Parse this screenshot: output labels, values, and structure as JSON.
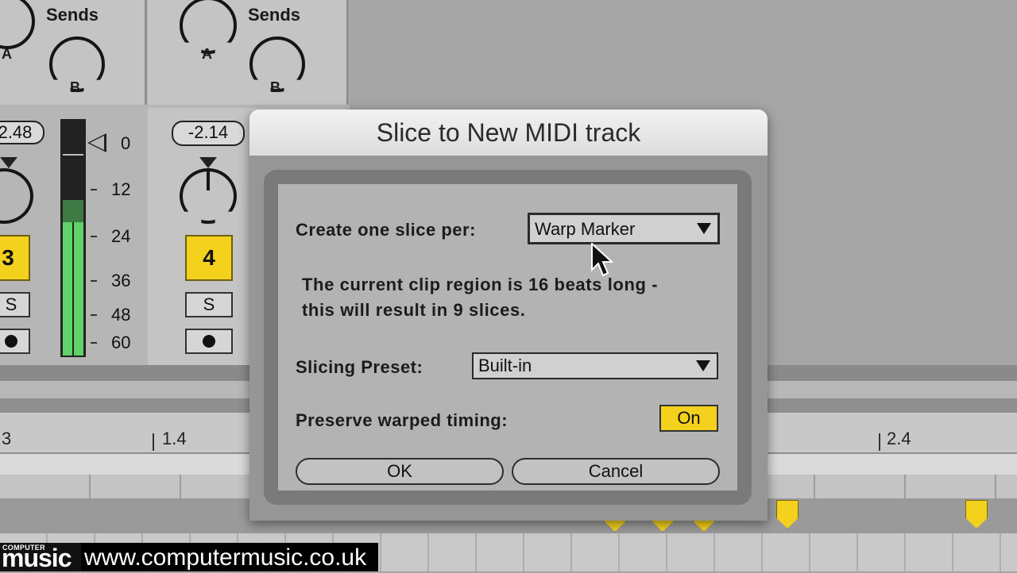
{
  "mixer": {
    "sends_title": "Sends",
    "knob_a": "A",
    "knob_b": "B",
    "tracks": [
      {
        "volume": "2.48",
        "number": "3",
        "solo": "S"
      },
      {
        "volume": "-2.14",
        "number": "4",
        "solo": "S"
      }
    ],
    "meter_scale": [
      "0",
      "12",
      "24",
      "36",
      "48",
      "60"
    ]
  },
  "arrangement": {
    "ruler": [
      "3",
      "1.4",
      "2.4"
    ]
  },
  "dialog": {
    "title": "Slice to New MIDI track",
    "slice_per_label": "Create one slice per:",
    "slice_per_value": "Warp Marker",
    "message_line1": "The current clip region is 16 beats long -",
    "message_line2": "this will result in 9 slices.",
    "preset_label": "Slicing Preset:",
    "preset_value": "Built-in",
    "preserve_label": "Preserve warped timing:",
    "preserve_value": "On",
    "ok_label": "OK",
    "cancel_label": "Cancel"
  },
  "watermark": {
    "logo_top": "COMPUTER",
    "logo_main": "music",
    "url": "www.computermusic.co.uk"
  },
  "colors": {
    "accent_yellow": "#f4d11c",
    "meter_green": "#5fd36a"
  }
}
